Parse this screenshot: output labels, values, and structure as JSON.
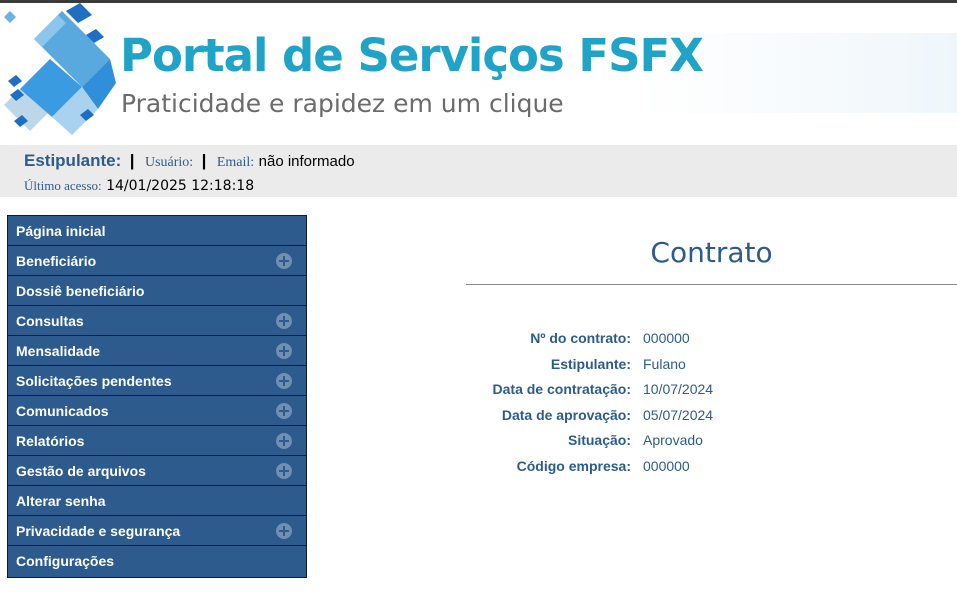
{
  "brand": {
    "title": "Portal de Serviços FSFX",
    "subtitle": "Praticidade e rapidez em um clique",
    "primary_color": "#1fa3c6",
    "menu_color": "#2e5b8e"
  },
  "userbar": {
    "estipulante_label": "Estipulante:",
    "separator": "|",
    "usuario_label": "Usuário:",
    "email_label": "Email:",
    "email_value": "não informado",
    "last_access_label": "Último acesso:",
    "last_access_value": "14/01/2025 12:18:18"
  },
  "menu": {
    "items": [
      {
        "label": "Página inicial",
        "expandable": false
      },
      {
        "label": "Beneficiário",
        "expandable": true
      },
      {
        "label": "Dossiê beneficiário",
        "expandable": false
      },
      {
        "label": "Consultas",
        "expandable": true
      },
      {
        "label": "Mensalidade",
        "expandable": true
      },
      {
        "label": "Solicitações pendentes",
        "expandable": true
      },
      {
        "label": "Comunicados",
        "expandable": true
      },
      {
        "label": "Relatórios",
        "expandable": true
      },
      {
        "label": "Gestão de arquivos",
        "expandable": true
      },
      {
        "label": "Alterar senha",
        "expandable": false
      },
      {
        "label": "Privacidade e segurança",
        "expandable": true
      },
      {
        "label": "Configurações",
        "expandable": false
      }
    ]
  },
  "content": {
    "title": "Contrato",
    "fields": [
      {
        "label": "Nº do contrato:",
        "value": "000000"
      },
      {
        "label": "Estipulante:",
        "value": "Fulano"
      },
      {
        "label": "Data de contratação:",
        "value": "10/07/2024"
      },
      {
        "label": "Data de aprovação:",
        "value": "05/07/2024"
      },
      {
        "label": "Situação:",
        "value": "Aprovado"
      },
      {
        "label": "Código empresa:",
        "value": "000000"
      }
    ]
  }
}
